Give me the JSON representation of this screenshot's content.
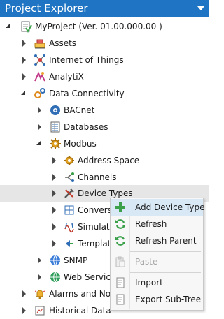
{
  "panel": {
    "title": "Project Explorer"
  },
  "tree": {
    "project": "MyProject (Ver. 01.00.000.00 )",
    "assets": "Assets",
    "iot": "Internet of Things",
    "analytix": "AnalytiX",
    "data_connectivity": "Data Connectivity",
    "bacnet": "BACnet",
    "databases": "Databases",
    "modbus": "Modbus",
    "address_space": "Address Space",
    "channels": "Channels",
    "device_types": "Device Types",
    "conversions": "Conversi",
    "simulate": "Simulate",
    "template": "Template",
    "snmp": "SNMP",
    "web_services": "Web Service:",
    "alarms": "Alarms and Noti",
    "historical": "Historical Data"
  },
  "context_menu": {
    "add_device_type": "Add Device Type",
    "refresh": "Refresh",
    "refresh_parent": "Refresh Parent",
    "paste": "Paste",
    "import": "Import",
    "export_subtree": "Export Sub-Tree"
  },
  "colors": {
    "titlebar": "#1f75c4",
    "selection": "#e6e6e6",
    "menu_hover": "#d8e8f5",
    "accent_green": "#3aa04a"
  }
}
